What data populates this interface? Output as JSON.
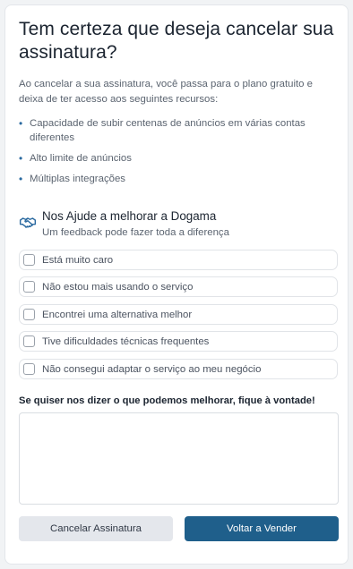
{
  "dialog": {
    "title": "Tem certeza que deseja cancelar sua assinatura?",
    "description": "Ao cancelar a sua assinatura, você passa para o plano gratuito e deixa de ter acesso aos seguintes recursos:",
    "features": [
      "Capacidade de subir centenas de anúncios em várias contas diferentes",
      "Alto limite de anúncios",
      "Múltiplas integrações"
    ]
  },
  "feedback": {
    "icon": "handshake-icon",
    "title": "Nos Ajude a melhorar a Dogama",
    "subtitle": "Um feedback pode fazer toda a diferença",
    "options": [
      {
        "label": "Está muito caro",
        "checked": false
      },
      {
        "label": "Não estou mais usando o serviço",
        "checked": false
      },
      {
        "label": "Encontrei uma alternativa melhor",
        "checked": false
      },
      {
        "label": "Tive dificuldades técnicas frequentes",
        "checked": false
      },
      {
        "label": "Não consegui adaptar o serviço ao meu negócio",
        "checked": false
      }
    ],
    "comment_label": "Se quiser nos dizer o que podemos melhorar, fique à vontade!",
    "comment_value": ""
  },
  "actions": {
    "cancel_label": "Cancelar Assinatura",
    "back_label": "Voltar a Vender"
  },
  "colors": {
    "primary": "#1f5f8b",
    "accent_icon": "#2b6aa0",
    "secondary_button": "#e4e7ec"
  }
}
